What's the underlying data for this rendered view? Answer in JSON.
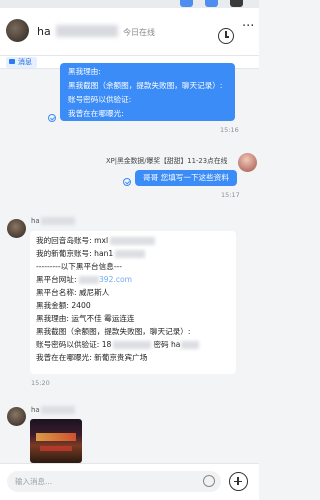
{
  "header": {
    "name": "ha",
    "status": "今日在线",
    "more": "···"
  },
  "tabs": {
    "message": "消息"
  },
  "sent_msg_1": {
    "lines": [
      "黑我理由:",
      "黑我截图（余额图，提款失败图，聊天记录）:",
      "账号密码以供验证:",
      "我曾在在哪曝光:"
    ],
    "time": "15:16"
  },
  "sender_banner": "XP|黑金数据/曝奖【甜甜】11-23点在线",
  "sent_msg_2": {
    "text": "哥哥 您填写一下这些资料",
    "time": "15:17"
  },
  "received_msg_1": {
    "sender": "ha",
    "lines": {
      "l1": "我的回音岛账号: mxl",
      "l2": "我的新葡京账号: han1",
      "l3": "---------以下黑平台信息---",
      "l4_prefix": "黑平台网址: ",
      "l4_url": "392.com",
      "l5": "黑平台名称: 威尼斯人",
      "l6": "黑我金额: 2400",
      "l7": "黑我理由: 运气不佳 霉运连连",
      "l8": "黑我截图（余额图，提款失败图，聊天记录）:",
      "l9_prefix": "账号密码以供验证: 18",
      "l9_mid": "密码 ha",
      "l10": "我曾在在哪曝光: 新葡京贵宾广场"
    },
    "time": "15:20"
  },
  "received_msg_2": {
    "sender": "ha"
  },
  "input": {
    "placeholder": "输入消息..."
  },
  "colors": {
    "accent": "#3c8cf8",
    "link": "#6fa8f3"
  }
}
